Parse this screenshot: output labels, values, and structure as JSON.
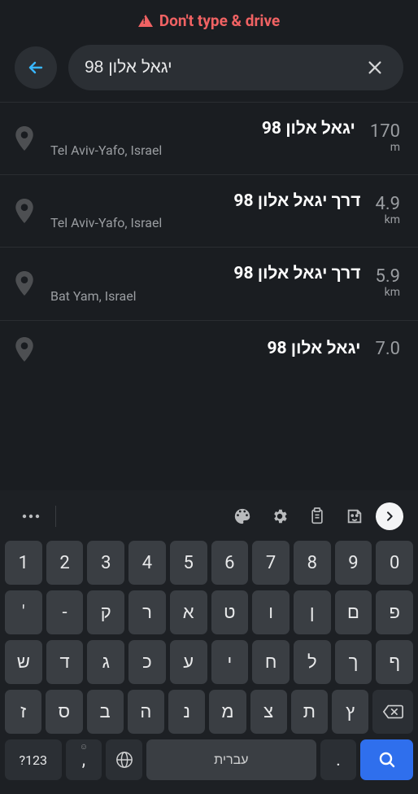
{
  "warning": {
    "text": "Don't type & drive"
  },
  "search": {
    "value": "יגאל אלון 98"
  },
  "results": [
    {
      "title": "יגאל אלון 98",
      "subtitle": "Tel Aviv-Yafo, Israel",
      "distance": "170",
      "unit": "m"
    },
    {
      "title": "דרך יגאל אלון 98",
      "subtitle": "Tel Aviv-Yafo, Israel",
      "distance": "4.9",
      "unit": "km"
    },
    {
      "title": "דרך יגאל אלון 98",
      "subtitle": "Bat Yam, Israel",
      "distance": "5.9",
      "unit": "km"
    },
    {
      "title": "יגאל אלון 98",
      "subtitle": "",
      "distance": "7.0",
      "unit": ""
    }
  ],
  "keyboard": {
    "row_numbers": [
      "1",
      "2",
      "3",
      "4",
      "5",
      "6",
      "7",
      "8",
      "9",
      "0"
    ],
    "row2": [
      "'",
      "-",
      "ק",
      "ר",
      "א",
      "ט",
      "ו",
      "ן",
      "ם",
      "פ"
    ],
    "row3": [
      "ש",
      "ד",
      "ג",
      "כ",
      "ע",
      "י",
      "ח",
      "ל",
      "ך",
      "ף"
    ],
    "row4": [
      "ז",
      "ס",
      "ב",
      "ה",
      "נ",
      "מ",
      "צ",
      "ת",
      "ץ"
    ],
    "key_123": "?123",
    "key_comma": ",",
    "key_space": "עברית",
    "key_dot": "."
  }
}
